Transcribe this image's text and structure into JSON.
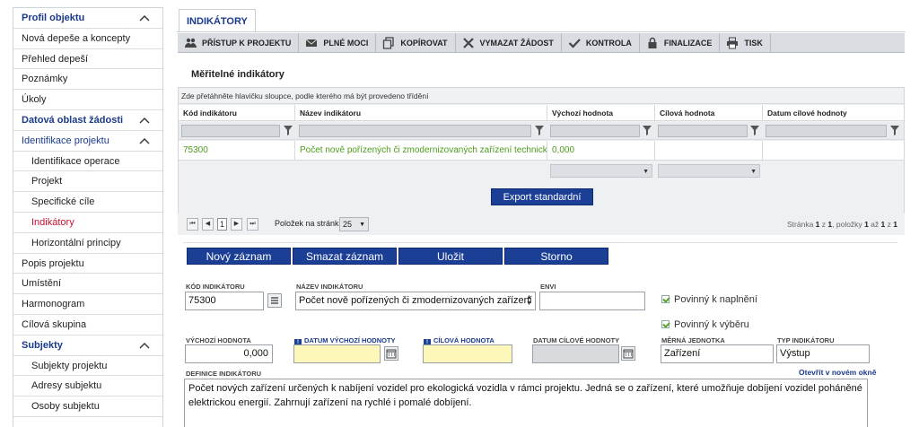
{
  "sidebar": {
    "items": [
      {
        "label": "Profil objektu",
        "kind": "head",
        "chevron": true
      },
      {
        "label": "Nová depeše a koncepty",
        "kind": "item"
      },
      {
        "label": "Přehled depeší",
        "kind": "item"
      },
      {
        "label": "Poznámky",
        "kind": "item"
      },
      {
        "label": "Úkoly",
        "kind": "item"
      },
      {
        "label": "Datová oblast žádosti",
        "kind": "head",
        "chevron": true
      },
      {
        "label": "Identifikace projektu",
        "kind": "head2",
        "chevron": true
      },
      {
        "label": "Identifikace operace",
        "kind": "sub"
      },
      {
        "label": "Projekt",
        "kind": "sub"
      },
      {
        "label": "Specifické cíle",
        "kind": "sub"
      },
      {
        "label": "Indikátory",
        "kind": "sub-active"
      },
      {
        "label": "Horizontální principy",
        "kind": "sub"
      },
      {
        "label": "Popis projektu",
        "kind": "item"
      },
      {
        "label": "Umístění",
        "kind": "item"
      },
      {
        "label": "Harmonogram",
        "kind": "item"
      },
      {
        "label": "Cílová skupina",
        "kind": "item"
      },
      {
        "label": "Subjekty",
        "kind": "head",
        "chevron": true
      },
      {
        "label": "Subjekty projektu",
        "kind": "sub"
      },
      {
        "label": "Adresy subjektu",
        "kind": "sub"
      },
      {
        "label": "Osoby subjektu",
        "kind": "sub"
      }
    ]
  },
  "tab": {
    "label": "INDIKÁTORY"
  },
  "toolbar": {
    "buttons": [
      {
        "label": "PŘÍSTUP K PROJEKTU",
        "icon": "users-icon"
      },
      {
        "label": "PLNÉ MOCI",
        "icon": "envelope-icon"
      },
      {
        "label": "KOPÍROVAT",
        "icon": "copy-icon"
      },
      {
        "label": "VYMAZAT ŽÁDOST",
        "icon": "x-icon"
      },
      {
        "label": "KONTROLA",
        "icon": "check-icon"
      },
      {
        "label": "FINALIZACE",
        "icon": "lock-icon"
      },
      {
        "label": "TISK",
        "icon": "printer-icon"
      }
    ]
  },
  "grid": {
    "title": "Měřitelné indikátory",
    "group_hint": "Zde přetáhněte hlavičku sloupce, podle kterého má být provedeno třídění",
    "columns": [
      "Kód indikátoru",
      "Název indikátoru",
      "Výchozí hodnota",
      "Cílová hodnota",
      "Datum cílové hodnoty"
    ],
    "rows": [
      [
        "75300",
        "Počet nově pořízených či zmodernizovaných zařízení technické...",
        "0,000",
        "",
        ""
      ]
    ],
    "export_label": "Export standardní"
  },
  "pager": {
    "first": "⏮",
    "prev": "◀",
    "current": "1",
    "next": "▶",
    "last": "⏭",
    "per_page_label": "Položek na stránku",
    "per_page_value": "25",
    "info_prefix": "Stránka",
    "page": "1",
    "of": "z",
    "total_pages": "1",
    "items_label": ", položky",
    "from": "1",
    "to_label": "až",
    "to": "1",
    "from_label": "z",
    "total": "1"
  },
  "actions": {
    "new": "Nový záznam",
    "delete": "Smazat záznam",
    "save": "Uložit",
    "cancel": "Storno"
  },
  "form": {
    "kod_label": "KÓD INDIKÁTORU",
    "kod_value": "75300",
    "nazev_label": "NÁZEV INDIKÁTORU",
    "nazev_value": "Počet nově pořízených či zmodernizovaných zařízení",
    "envi_label": "ENVI",
    "envi_value": "",
    "povinny_naplneni": "Povinný k naplnění",
    "povinny_vyberu": "Povinný k výběru",
    "vychozi_label": "VÝCHOZÍ HODNOTA",
    "vychozi_value": "0,000",
    "datum_vychozi_label": "DATUM VÝCHOZÍ HODNOTY",
    "cilova_label": "CÍLOVÁ HODNOTA",
    "datum_cilove_label": "DATUM CÍLOVÉ HODNOTY",
    "merna_label": "MĚRNÁ JEDNOTKA",
    "merna_value": "Zařízení",
    "typ_label": "TYP INDIKÁTORU",
    "typ_value": "Výstup",
    "definice_label": "DEFINICE INDIKÁTORU",
    "open_link": "Otevřít v novém okně",
    "definice_value": "Počet nových zařízení určených k nabíjení vozidel pro ekologická vozidla v rámci projektu. Jedná se o zařízení, které umožňuje dobíjení vozidel poháněné elektrickou energií. Zahrnují zařízení na rychlé i pomalé dobíjení.",
    "req_mark": "!"
  },
  "colors": {
    "accent": "#1c3f96",
    "link_green": "#4c9c1c",
    "active_red": "#c8102e",
    "required_yellow": "#fdf7b9"
  }
}
